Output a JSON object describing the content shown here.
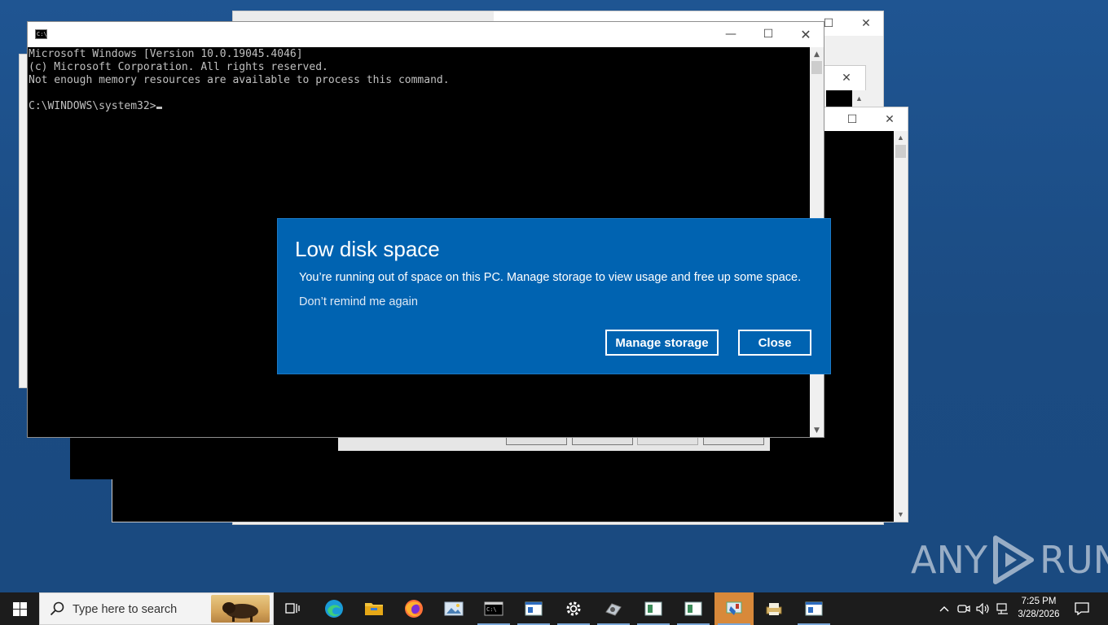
{
  "cmd": {
    "lines": [
      "Microsoft Windows [Version 10.0.19045.4046]",
      "(c) Microsoft Corporation. All rights reserved.",
      "Not enough memory resources are available to process this command.",
      "",
      "C:\\WINDOWS\\system32>"
    ],
    "icon_label": "C:\\",
    "minimize_glyph": "—",
    "maximize_glyph": "☐",
    "close_glyph": "✕"
  },
  "toast": {
    "title": "Low disk space",
    "message": "You’re running out of space on this PC. Manage storage to view usage and free up some space.",
    "dismiss_link": "Don’t remind me again",
    "primary_button": "Manage storage",
    "secondary_button": "Close",
    "background_color": "#0063b1"
  },
  "watermark": {
    "left_text": "ANY",
    "right_text": "RUN"
  },
  "taskbar": {
    "search_placeholder": "Type here to search",
    "icons": [
      "task-view-icon",
      "edge-icon",
      "file-explorer-icon",
      "firefox-icon",
      "photo-viewer-icon",
      "cmd-icon",
      "window-app-icon",
      "settings-icon",
      "network-app-icon",
      "window-app-icon",
      "window-app-icon",
      "control-panel-icon",
      "printer-app-icon",
      "window-app-icon"
    ],
    "tray": {
      "time": "7:25 PM",
      "date": "3/28/2026"
    }
  }
}
